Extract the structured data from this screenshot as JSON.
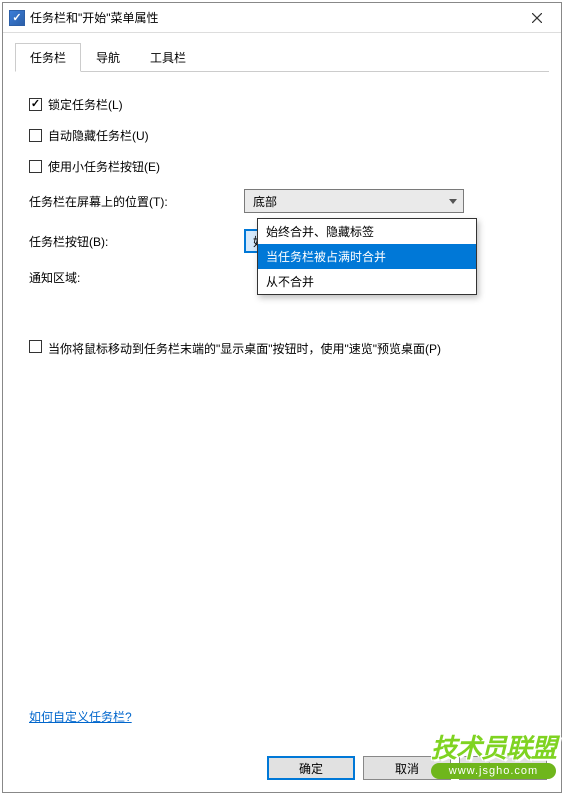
{
  "titlebar": {
    "title": "任务栏和\"开始\"菜单属性"
  },
  "tabs": {
    "items": [
      {
        "label": "任务栏"
      },
      {
        "label": "导航"
      },
      {
        "label": "工具栏"
      }
    ]
  },
  "form": {
    "lock_taskbar": "锁定任务栏(L)",
    "auto_hide": "自动隐藏任务栏(U)",
    "small_buttons": "使用小任务栏按钮(E)",
    "position_label": "任务栏在屏幕上的位置(T):",
    "position_value": "底部",
    "buttons_label": "任务栏按钮(B):",
    "buttons_value": "始终合并、隐藏标签",
    "notify_label": "通知区域:",
    "preview_desktop": "当你将鼠标移动到任务栏末端的\"显示桌面\"按钮时，使用\"速览\"预览桌面(P)",
    "customize_link": "如何自定义任务栏?"
  },
  "dropdown": {
    "options": [
      "始终合并、隐藏标签",
      "当任务栏被占满时合并",
      "从不合并"
    ]
  },
  "buttons": {
    "ok": "确定",
    "cancel": "取消",
    "apply": "应用(A)"
  },
  "overlay": {
    "brand": "技术员联盟",
    "url": "www.jsgho.com"
  }
}
